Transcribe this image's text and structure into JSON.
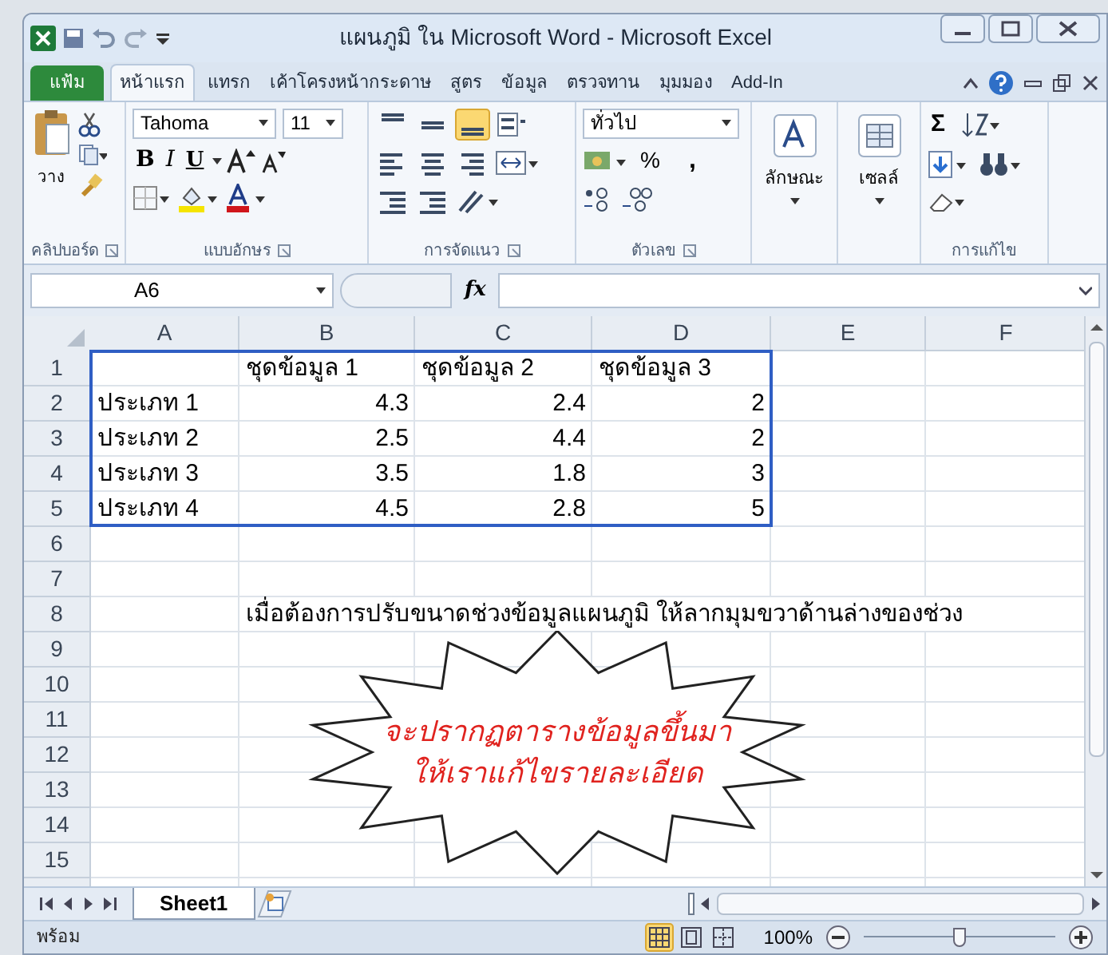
{
  "window": {
    "title": "แผนภูมิ ใน Microsoft Word - Microsoft Excel"
  },
  "ribbon": {
    "file_tab": "แฟ้ม",
    "tabs": [
      {
        "label": "หน้าแรก",
        "selected": true
      },
      {
        "label": "แทรก",
        "selected": false
      },
      {
        "label": "เค้าโครงหน้ากระดาษ",
        "selected": false
      },
      {
        "label": "สูตร",
        "selected": false
      },
      {
        "label": "ข้อมูล",
        "selected": false
      },
      {
        "label": "ตรวจทาน",
        "selected": false
      },
      {
        "label": "มุมมอง",
        "selected": false
      },
      {
        "label": "Add-In",
        "selected": false
      }
    ],
    "clipboard": {
      "paste_label": "วาง",
      "group_label": "คลิปบอร์ด"
    },
    "font": {
      "name": "Tahoma",
      "size": "11",
      "bold": "B",
      "italic": "I",
      "underline": "U",
      "group_label": "แบบอักษร"
    },
    "alignment": {
      "bottom_align_selected": true,
      "group_label": "การจัดแนว"
    },
    "number": {
      "format": "ทั่วไป",
      "percent": "%",
      "comma": ",",
      "group_label": "ตัวเลข"
    },
    "styles": {
      "label": "ลักษณะ"
    },
    "cells": {
      "label": "เซลล์"
    },
    "editing": {
      "sum": "Σ",
      "group_label": "การแก้ไข"
    }
  },
  "formula_bar": {
    "name_box": "A6",
    "fx": "fx"
  },
  "sheet": {
    "columns": [
      "A",
      "B",
      "C",
      "D",
      "E",
      "F"
    ],
    "row_headers": [
      "1",
      "2",
      "3",
      "4",
      "5",
      "6",
      "7",
      "8",
      "9",
      "10",
      "11",
      "12",
      "13",
      "14",
      "15"
    ],
    "data_table": {
      "series": [
        "ชุดข้อมูล 1",
        "ชุดข้อมูล 2",
        "ชุดข้อมูล 3"
      ],
      "rows": [
        {
          "category": "ประเภท 1",
          "values": [
            "4.3",
            "2.4",
            "2"
          ]
        },
        {
          "category": "ประเภท 2",
          "values": [
            "2.5",
            "4.4",
            "2"
          ]
        },
        {
          "category": "ประเภท 3",
          "values": [
            "3.5",
            "1.8",
            "3"
          ]
        },
        {
          "category": "ประเภท 4",
          "values": [
            "4.5",
            "2.8",
            "5"
          ]
        }
      ]
    },
    "note": "เมื่อต้องการปรับขนาดช่วงข้อมูลแผนภูมิ ให้ลากมุมขวาด้านล่างของช่วง",
    "callout": {
      "lines": [
        "จะปรากฏตารางข้อมูลขึ้นมา",
        "ให้เราแก้ไขรายละเอียด"
      ]
    }
  },
  "sheet_tabs": [
    {
      "label": "Sheet1",
      "selected": true
    }
  ],
  "status_bar": {
    "mode": "พร้อม",
    "views": [
      {
        "kind": "normal",
        "selected": true
      },
      {
        "kind": "page_layout",
        "selected": false
      },
      {
        "kind": "page_break",
        "selected": false
      }
    ],
    "zoom": "100%",
    "zoom_slider": {
      "level": 0.5
    }
  }
}
